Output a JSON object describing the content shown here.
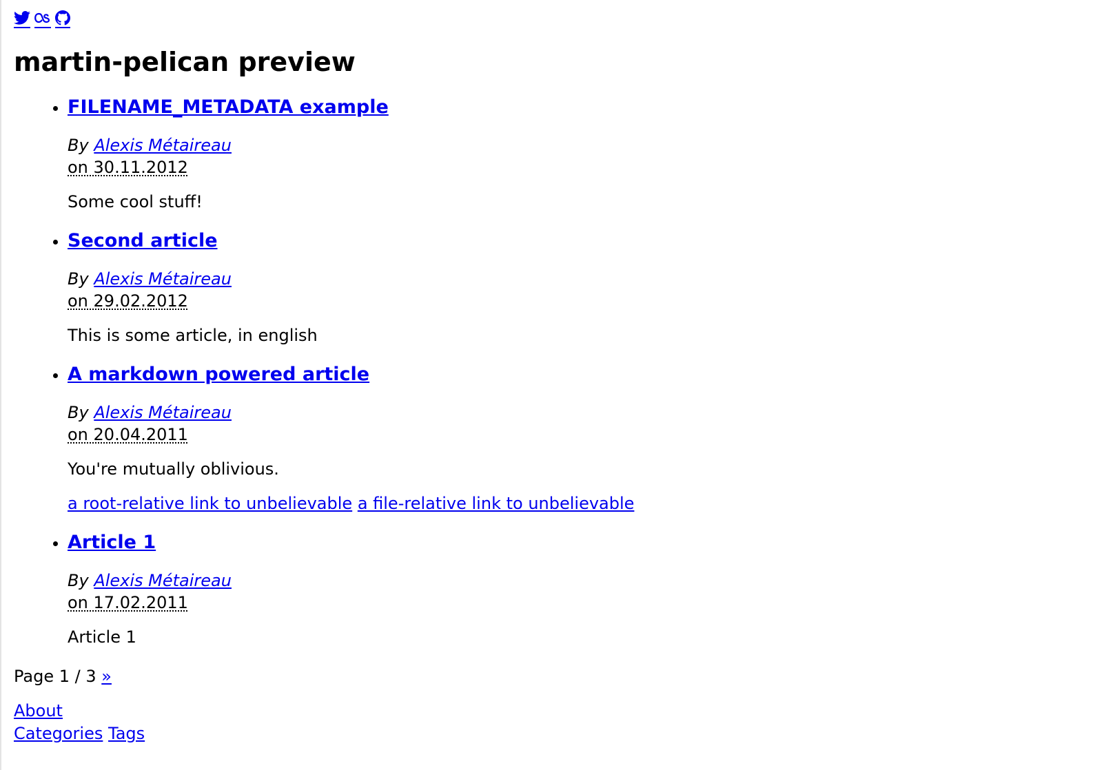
{
  "social": {
    "twitter_icon": "twitter-icon",
    "lastfm_icon": "lastfm-icon",
    "github_icon": "github-icon"
  },
  "site_title": "martin-pelican preview",
  "articles": [
    {
      "title": "FILENAME_METADATA example",
      "by": "By",
      "author": "Alexis Métaireau",
      "date": "on 30.11.2012",
      "summary": "Some cool stuff!"
    },
    {
      "title": "Second article",
      "by": "By",
      "author": "Alexis Métaireau",
      "date": "on 29.02.2012",
      "summary": "This is some article, in english"
    },
    {
      "title": "A markdown powered article",
      "by": "By",
      "author": "Alexis Métaireau",
      "date": "on 20.04.2011",
      "summary": "You're mutually oblivious.",
      "extra_links": [
        "a root-relative link to unbelievable",
        "a file-relative link to unbelievable"
      ]
    },
    {
      "title": "Article 1",
      "by": "By",
      "author": "Alexis Métaireau",
      "date": "on 17.02.2011",
      "summary": "Article 1"
    }
  ],
  "pagination": {
    "label": "Page 1 / 3",
    "next": "»"
  },
  "footer": {
    "about": "About",
    "categories": "Categories",
    "tags": "Tags"
  },
  "colors": {
    "link": "#0000ee",
    "text": "#000000",
    "background": "#ffffff"
  }
}
